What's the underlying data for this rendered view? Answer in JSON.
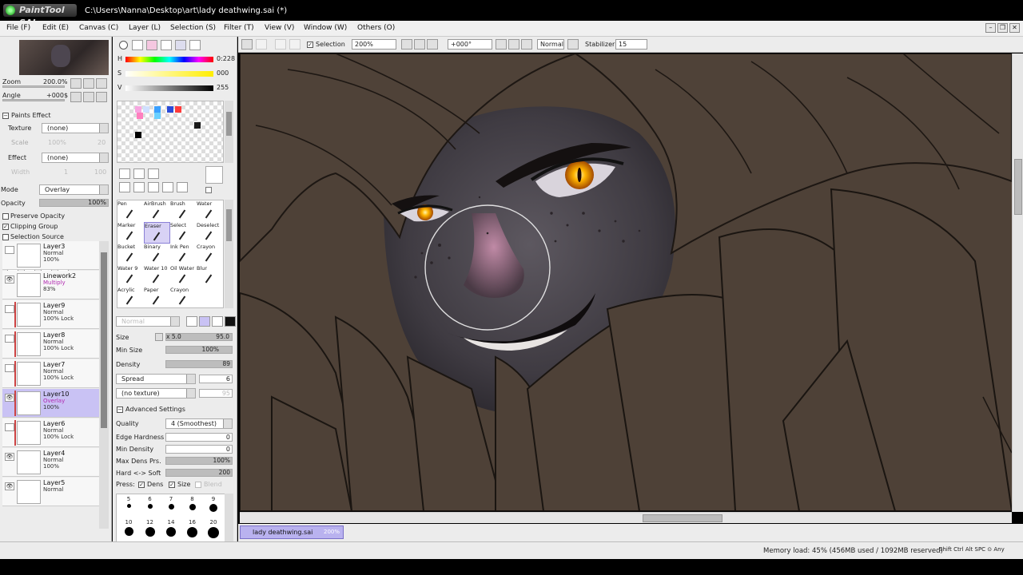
{
  "window": {
    "logo": "PaintTool SAI",
    "title": "C:\\Users\\Nanna\\Desktop\\art\\lady deathwing.sai (*)"
  },
  "menu": [
    {
      "label": "File (F)"
    },
    {
      "label": "Edit (E)"
    },
    {
      "label": "Canvas (C)"
    },
    {
      "label": "Layer (L)"
    },
    {
      "label": "Selection (S)"
    },
    {
      "label": "Filter (T)"
    },
    {
      "label": "View (V)"
    },
    {
      "label": "Window (W)"
    },
    {
      "label": "Others (O)"
    }
  ],
  "navigator": {
    "zoom_label": "Zoom",
    "zoom_value": "200.0%",
    "angle_label": "Angle",
    "angle_value": "+000$"
  },
  "paints_effect": {
    "header": "Paints Effect",
    "texture_label": "Texture",
    "texture_value": "(none)",
    "scale_label": "Scale",
    "scale_value": "100%",
    "scale_num": "20",
    "effect_label": "Effect",
    "effect_value": "(none)",
    "width_label": "Width",
    "width_num": "1",
    "width_num2": "100"
  },
  "layer_props": {
    "mode_label": "Mode",
    "mode_value": "Overlay",
    "opacity_label": "Opacity",
    "opacity_value": "100%",
    "preserve_opacity": "Preserve Opacity",
    "clipping_group": "Clipping Group",
    "selection_source": "Selection Source"
  },
  "layers": [
    {
      "name": "Layer3",
      "mode": "Normal",
      "opacity": "100%",
      "visible": false,
      "clip": false,
      "selected": false
    },
    {
      "name": "Linework2",
      "mode": "Multiply",
      "opacity": "83%",
      "visible": true,
      "clip": false,
      "selected": false,
      "pink": true
    },
    {
      "name": "Layer9",
      "mode": "Normal",
      "opacity": "100% Lock",
      "visible": false,
      "clip": true,
      "selected": false
    },
    {
      "name": "Layer8",
      "mode": "Normal",
      "opacity": "100% Lock",
      "visible": false,
      "clip": true,
      "selected": false
    },
    {
      "name": "Layer7",
      "mode": "Normal",
      "opacity": "100% Lock",
      "visible": false,
      "clip": true,
      "selected": false
    },
    {
      "name": "Layer10",
      "mode": "Overlay",
      "opacity": "100%",
      "visible": true,
      "clip": true,
      "selected": true,
      "pink": true
    },
    {
      "name": "Layer6",
      "mode": "Normal",
      "opacity": "100% Lock",
      "visible": false,
      "clip": true,
      "selected": false
    },
    {
      "name": "Layer4",
      "mode": "Normal",
      "opacity": "100%",
      "visible": true,
      "clip": false,
      "selected": false
    },
    {
      "name": "Layer5",
      "mode": "Normal",
      "opacity": "",
      "visible": true,
      "clip": false,
      "selected": false
    }
  ],
  "color": {
    "h_label": "H",
    "h_value": "0:228",
    "s_label": "S",
    "s_value": "000",
    "v_label": "V",
    "v_value": "255"
  },
  "swatch_colors": [
    "#f7a6e0",
    "#cfe0ff",
    "#3aa0ff",
    "#2b4bd8",
    "#ff7fbf",
    "#6ad0ff",
    "#ff3b3b",
    "#1a1a1a",
    "#000000"
  ],
  "brushes": [
    {
      "label": "Pen"
    },
    {
      "label": "AirBrush"
    },
    {
      "label": "Brush"
    },
    {
      "label": "Water"
    },
    {
      "label": "Marker"
    },
    {
      "label": "Eraser",
      "selected": true
    },
    {
      "label": "Select"
    },
    {
      "label": "Deselect"
    },
    {
      "label": "Bucket"
    },
    {
      "label": "Binary"
    },
    {
      "label": "Ink Pen"
    },
    {
      "label": "Crayon"
    },
    {
      "label": "Water 9"
    },
    {
      "label": "Water 10"
    },
    {
      "label": "Oil Water"
    },
    {
      "label": "Blur"
    },
    {
      "label": "Acrylic"
    },
    {
      "label": "Paper"
    },
    {
      "label": "Crayon"
    },
    {
      "label": ""
    }
  ],
  "brush_settings": {
    "blend_mode": "Normal",
    "size_label": "Size",
    "size_mult": "x 5.0",
    "size_value": "95.0",
    "minsize_label": "Min Size",
    "minsize_value": "100%",
    "density_label": "Density",
    "density_value": "89",
    "spread_label": "Spread",
    "spread_value": "6",
    "texture_label": "(no texture)",
    "texture_value": "95",
    "advanced_label": "Advanced Settings",
    "quality_label": "Quality",
    "quality_value": "4 (Smoothest)",
    "edge_label": "Edge Hardness",
    "edge_value": "0",
    "mindens_label": "Min Density",
    "mindens_value": "0",
    "maxdens_label": "Max Dens Prs.",
    "maxdens_value": "100%",
    "hardsoft_label": "Hard <-> Soft",
    "hardsoft_value": "200",
    "press_label": "Press:",
    "press_dens": "Dens",
    "press_size": "Size",
    "press_blend": "Blend"
  },
  "brush_sizes": [
    {
      "label": "5",
      "d": 5
    },
    {
      "label": "6",
      "d": 6
    },
    {
      "label": "7",
      "d": 7
    },
    {
      "label": "8",
      "d": 8
    },
    {
      "label": "9",
      "d": 10
    },
    {
      "label": "10",
      "d": 11
    },
    {
      "label": "12",
      "d": 12
    },
    {
      "label": "14",
      "d": 12
    },
    {
      "label": "16",
      "d": 13
    },
    {
      "label": "20",
      "d": 14
    }
  ],
  "canvas_toolbar": {
    "selection_label": "Selection",
    "zoom_value": "200%",
    "angle_value": "+000°",
    "blend_value": "Normal",
    "stabilizer_label": "Stabilizer",
    "stabilizer_value": "15"
  },
  "tabs": {
    "file": "lady deathwing.sai",
    "file_zoom": "200%"
  },
  "status": {
    "memory": "Memory load: 45% (456MB used / 1092MB reserved)",
    "keys": "Shift Ctrl Alt SPC ⊙ Any"
  }
}
